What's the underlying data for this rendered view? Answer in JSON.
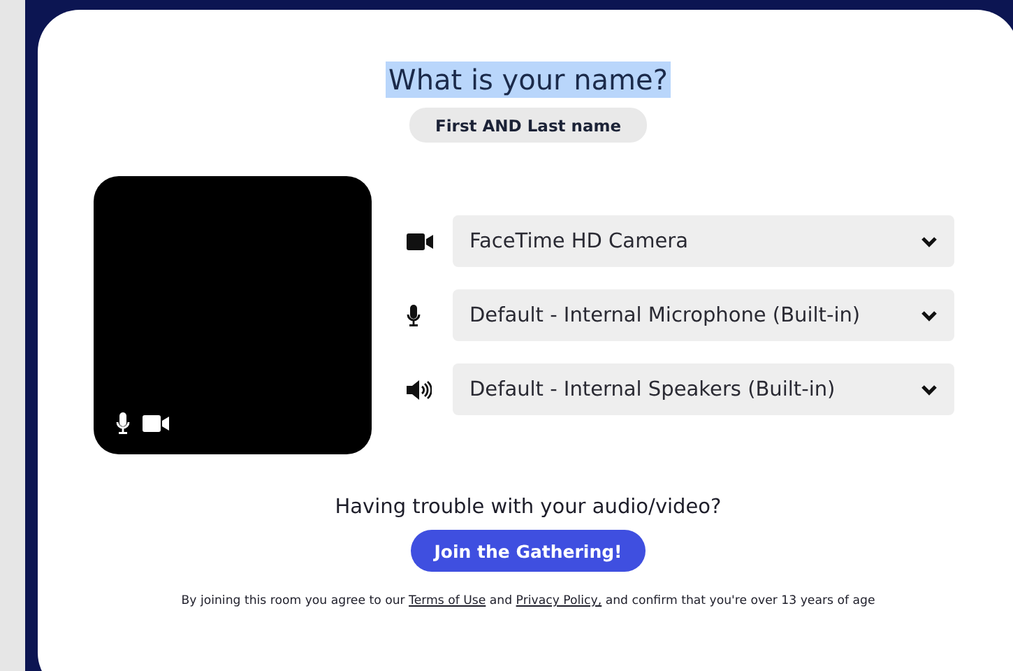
{
  "title": "What is your name?",
  "name_field": {
    "placeholder": "First AND Last name"
  },
  "preview": {
    "mic_on": true,
    "camera_on": true
  },
  "devices": [
    {
      "kind": "camera",
      "label": "FaceTime HD Camera"
    },
    {
      "kind": "microphone",
      "label": "Default - Internal Microphone (Built-in)"
    },
    {
      "kind": "speaker",
      "label": "Default - Internal Speakers (Built-in)"
    }
  ],
  "trouble_text": "Having trouble with your audio/video?",
  "join_button": "Join the Gathering!",
  "consent": {
    "before": "By joining this room you agree to our",
    "terms_link": "Terms of Use",
    "middle": "and",
    "privacy_link": "Privacy Policy,",
    "after": "and confirm that you're over 13 years of age"
  }
}
